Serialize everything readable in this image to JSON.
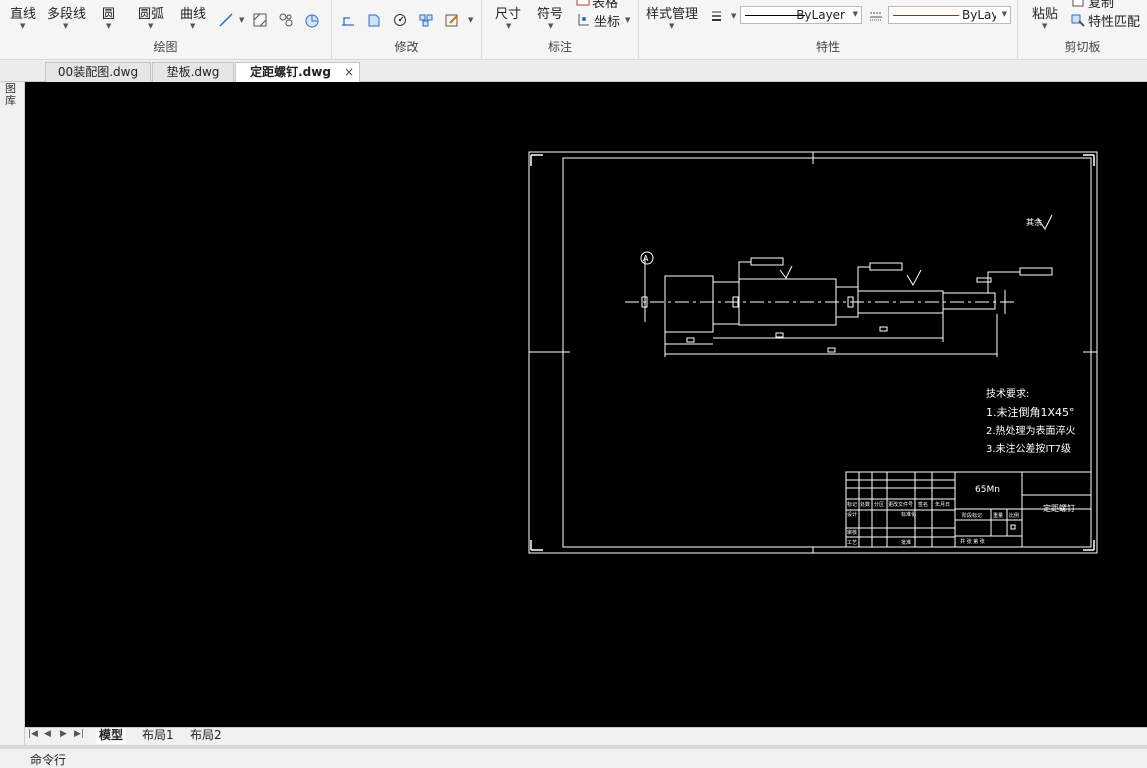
{
  "ribbon": {
    "draw": {
      "label": "绘图",
      "line": "直线",
      "polyline": "多段线",
      "circle": "圆",
      "arc": "圆弧",
      "curve": "曲线"
    },
    "modify": {
      "label": "修改"
    },
    "annotate": {
      "label": "标注",
      "dimension": "尺寸",
      "symbol": "符号",
      "table": "表格",
      "coordinate": "坐标"
    },
    "properties": {
      "label": "特性",
      "style_manager": "样式管理",
      "linetype": "ByLayer",
      "color": "ByLayer",
      "linetype_color": "#000000",
      "color_swatch": "#ff0000"
    },
    "clipboard": {
      "label": "剪切板",
      "paste": "粘贴",
      "copy": "复制",
      "match_props": "特性匹配"
    }
  },
  "tabs": [
    {
      "label": "00装配图.dwg"
    },
    {
      "label": "垫板.dwg"
    },
    {
      "label": "定距螺钉.dwg",
      "active": true
    }
  ],
  "side_panel": {
    "label": "图库"
  },
  "drawing": {
    "datum": "A",
    "roughness_note": "其余",
    "tech_title": "技术要求:",
    "tech_1": "1.未注倒角1X45°",
    "tech_2": "2.热处理为表面淬火",
    "tech_3": "3.未注公差按IT7级",
    "material": "65Mn",
    "part_name": "定距螺钉",
    "tb_mark": "标记",
    "tb_count": "处数",
    "tb_zone": "分区",
    "tb_docno": "更改文件号",
    "tb_sign": "签名",
    "tb_date": "年月日",
    "tb_design": "设计",
    "tb_standard": "标准化",
    "tb_review": "审核",
    "tb_process": "工艺",
    "tb_approve": "批准",
    "tb_stage": "阶段标记",
    "tb_weight": "重量",
    "tb_scale": "比例",
    "tb_sheets": "共 张 第 张"
  },
  "layout_tabs": [
    {
      "label": "模型",
      "active": true
    },
    {
      "label": "布局1"
    },
    {
      "label": "布局2"
    }
  ],
  "command": {
    "label": "命令行"
  }
}
